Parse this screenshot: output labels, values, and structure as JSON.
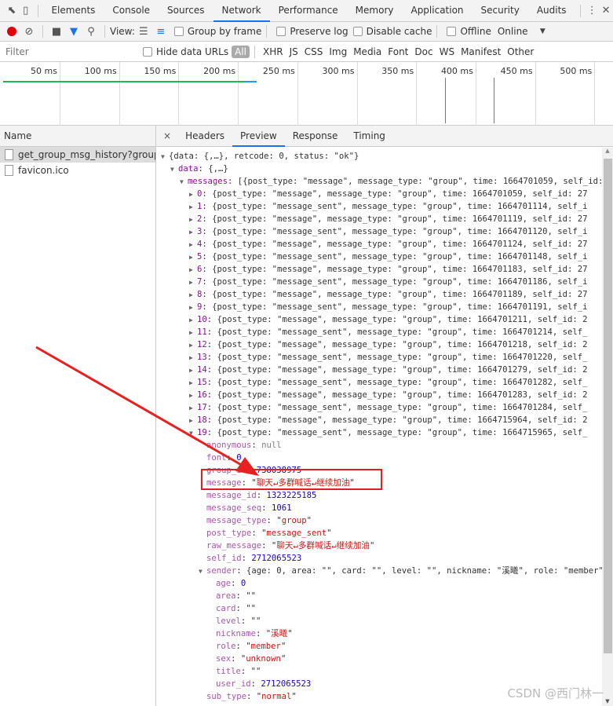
{
  "tabs": [
    "Elements",
    "Console",
    "Sources",
    "Network",
    "Performance",
    "Memory",
    "Application",
    "Security",
    "Audits"
  ],
  "active_tab": "Network",
  "toolbar": {
    "view_label": "View:",
    "group_by_frame": "Group by frame",
    "preserve_log": "Preserve log",
    "disable_cache": "Disable cache",
    "offline": "Offline",
    "throttle": "Online"
  },
  "filter": {
    "placeholder": "Filter",
    "hide_data_urls": "Hide data URLs",
    "types": [
      "All",
      "XHR",
      "JS",
      "CSS",
      "Img",
      "Media",
      "Font",
      "Doc",
      "WS",
      "Manifest",
      "Other"
    ]
  },
  "timeline": {
    "ticks": [
      "50 ms",
      "100 ms",
      "150 ms",
      "200 ms",
      "250 ms",
      "300 ms",
      "350 ms",
      "400 ms",
      "450 ms",
      "500 ms"
    ]
  },
  "requests": {
    "header": "Name",
    "items": [
      "get_group_msg_history?group...",
      "favicon.ico"
    ],
    "selected": 0
  },
  "detail_tabs": [
    "Headers",
    "Preview",
    "Response",
    "Timing"
  ],
  "active_detail_tab": "Preview",
  "colors": {
    "accent": "#1a73e8",
    "record": "#e00000",
    "highlight_box": "#e02020"
  },
  "preview": [
    {
      "i": 0,
      "a": "down",
      "t": [
        [
          "p",
          "{data: {,…}, retcode: 0, status: \"ok\"}"
        ]
      ]
    },
    {
      "i": 1,
      "a": "down",
      "t": [
        [
          "k",
          "data"
        ],
        [
          "p",
          ": {,…}"
        ]
      ]
    },
    {
      "i": 2,
      "a": "down",
      "t": [
        [
          "k",
          "messages"
        ],
        [
          "p",
          ": [{post_type: \"message\", message_type: \"group\", time: 1664701059, self_id: 2712065523"
        ]
      ]
    },
    {
      "i": 3,
      "a": "right",
      "t": [
        [
          "k",
          "0"
        ],
        [
          "p",
          ": {post_type: \"message\", message_type: \"group\", time: 1664701059, self_id: 27"
        ]
      ]
    },
    {
      "i": 3,
      "a": "right",
      "t": [
        [
          "k",
          "1"
        ],
        [
          "p",
          ": {post_type: \"message_sent\", message_type: \"group\", time: 1664701114, self_i"
        ]
      ]
    },
    {
      "i": 3,
      "a": "right",
      "t": [
        [
          "k",
          "2"
        ],
        [
          "p",
          ": {post_type: \"message\", message_type: \"group\", time: 1664701119, self_id: 27"
        ]
      ]
    },
    {
      "i": 3,
      "a": "right",
      "t": [
        [
          "k",
          "3"
        ],
        [
          "p",
          ": {post_type: \"message_sent\", message_type: \"group\", time: 1664701120, self_i"
        ]
      ]
    },
    {
      "i": 3,
      "a": "right",
      "t": [
        [
          "k",
          "4"
        ],
        [
          "p",
          ": {post_type: \"message\", message_type: \"group\", time: 1664701124, self_id: 27"
        ]
      ]
    },
    {
      "i": 3,
      "a": "right",
      "t": [
        [
          "k",
          "5"
        ],
        [
          "p",
          ": {post_type: \"message_sent\", message_type: \"group\", time: 1664701148, self_i"
        ]
      ]
    },
    {
      "i": 3,
      "a": "right",
      "t": [
        [
          "k",
          "6"
        ],
        [
          "p",
          ": {post_type: \"message\", message_type: \"group\", time: 1664701183, self_id: 27"
        ]
      ]
    },
    {
      "i": 3,
      "a": "right",
      "t": [
        [
          "k",
          "7"
        ],
        [
          "p",
          ": {post_type: \"message_sent\", message_type: \"group\", time: 1664701186, self_i"
        ]
      ]
    },
    {
      "i": 3,
      "a": "right",
      "t": [
        [
          "k",
          "8"
        ],
        [
          "p",
          ": {post_type: \"message\", message_type: \"group\", time: 1664701189, self_id: 27"
        ]
      ]
    },
    {
      "i": 3,
      "a": "right",
      "t": [
        [
          "k",
          "9"
        ],
        [
          "p",
          ": {post_type: \"message_sent\", message_type: \"group\", time: 1664701191, self_i"
        ]
      ]
    },
    {
      "i": 3,
      "a": "right",
      "t": [
        [
          "k",
          "10"
        ],
        [
          "p",
          ": {post_type: \"message\", message_type: \"group\", time: 1664701211, self_id: 2"
        ]
      ]
    },
    {
      "i": 3,
      "a": "right",
      "t": [
        [
          "k",
          "11"
        ],
        [
          "p",
          ": {post_type: \"message_sent\", message_type: \"group\", time: 1664701214, self_"
        ]
      ]
    },
    {
      "i": 3,
      "a": "right",
      "t": [
        [
          "k",
          "12"
        ],
        [
          "p",
          ": {post_type: \"message\", message_type: \"group\", time: 1664701218, self_id: 2"
        ]
      ]
    },
    {
      "i": 3,
      "a": "right",
      "t": [
        [
          "k",
          "13"
        ],
        [
          "p",
          ": {post_type: \"message_sent\", message_type: \"group\", time: 1664701220, self_"
        ]
      ]
    },
    {
      "i": 3,
      "a": "right",
      "t": [
        [
          "k",
          "14"
        ],
        [
          "p",
          ": {post_type: \"message\", message_type: \"group\", time: 1664701279, self_id: 2"
        ]
      ]
    },
    {
      "i": 3,
      "a": "right",
      "t": [
        [
          "k",
          "15"
        ],
        [
          "p",
          ": {post_type: \"message_sent\", message_type: \"group\", time: 1664701282, self_"
        ]
      ]
    },
    {
      "i": 3,
      "a": "right",
      "t": [
        [
          "k",
          "16"
        ],
        [
          "p",
          ": {post_type: \"message\", message_type: \"group\", time: 1664701283, self_id: 2"
        ]
      ]
    },
    {
      "i": 3,
      "a": "right",
      "t": [
        [
          "k",
          "17"
        ],
        [
          "p",
          ": {post_type: \"message_sent\", message_type: \"group\", time: 1664701284, self_"
        ]
      ]
    },
    {
      "i": 3,
      "a": "right",
      "t": [
        [
          "k",
          "18"
        ],
        [
          "p",
          ": {post_type: \"message\", message_type: \"group\", time: 1664715964, self_id: 2"
        ]
      ]
    },
    {
      "i": 3,
      "a": "down",
      "t": [
        [
          "k",
          "19"
        ],
        [
          "p",
          ": {post_type: \"message_sent\", message_type: \"group\", time: 1664715965, self_"
        ]
      ]
    },
    {
      "i": 4,
      "a": "",
      "t": [
        [
          "k2",
          "anonymous"
        ],
        [
          "p",
          ": "
        ],
        [
          "nl",
          "null"
        ]
      ]
    },
    {
      "i": 4,
      "a": "",
      "t": [
        [
          "k2",
          "font"
        ],
        [
          "p",
          ": "
        ],
        [
          "n",
          "0"
        ]
      ]
    },
    {
      "i": 4,
      "a": "",
      "t": [
        [
          "k2",
          "group_id"
        ],
        [
          "p",
          ": "
        ],
        [
          "n",
          "738038975"
        ]
      ]
    },
    {
      "i": 4,
      "a": "",
      "t": [
        [
          "k2",
          "message"
        ],
        [
          "p",
          ": \""
        ],
        [
          "s",
          "聊天↵多群喊话↵继续加油"
        ],
        [
          "p",
          "\""
        ]
      ]
    },
    {
      "i": 4,
      "a": "",
      "t": [
        [
          "k2",
          "message_id"
        ],
        [
          "p",
          ": "
        ],
        [
          "n",
          "1323225185"
        ]
      ]
    },
    {
      "i": 4,
      "a": "",
      "t": [
        [
          "k2",
          "message_seq"
        ],
        [
          "p",
          ": "
        ],
        [
          "n",
          "1061"
        ]
      ]
    },
    {
      "i": 4,
      "a": "",
      "t": [
        [
          "k2",
          "message_type"
        ],
        [
          "p",
          ": \""
        ],
        [
          "s",
          "group"
        ],
        [
          "p",
          "\""
        ]
      ]
    },
    {
      "i": 4,
      "a": "",
      "t": [
        [
          "k2",
          "post_type"
        ],
        [
          "p",
          ": \""
        ],
        [
          "s",
          "message_sent"
        ],
        [
          "p",
          "\""
        ]
      ]
    },
    {
      "i": 4,
      "a": "",
      "t": [
        [
          "k2",
          "raw_message"
        ],
        [
          "p",
          ": \""
        ],
        [
          "s",
          "聊天↵多群喊话↵继续加油"
        ],
        [
          "p",
          "\""
        ]
      ]
    },
    {
      "i": 4,
      "a": "",
      "t": [
        [
          "k2",
          "self_id"
        ],
        [
          "p",
          ": "
        ],
        [
          "n",
          "2712065523"
        ]
      ]
    },
    {
      "i": 4,
      "a": "down",
      "t": [
        [
          "k2",
          "sender"
        ],
        [
          "p",
          ": {age: 0, area: \"\", card: \"\", level: \"\", nickname: \"溪曦\", role: \"member\""
        ]
      ]
    },
    {
      "i": 5,
      "a": "",
      "t": [
        [
          "k2",
          "age"
        ],
        [
          "p",
          ": "
        ],
        [
          "n",
          "0"
        ]
      ]
    },
    {
      "i": 5,
      "a": "",
      "t": [
        [
          "k2",
          "area"
        ],
        [
          "p",
          ": \"\""
        ]
      ]
    },
    {
      "i": 5,
      "a": "",
      "t": [
        [
          "k2",
          "card"
        ],
        [
          "p",
          ": \"\""
        ]
      ]
    },
    {
      "i": 5,
      "a": "",
      "t": [
        [
          "k2",
          "level"
        ],
        [
          "p",
          ": \"\""
        ]
      ]
    },
    {
      "i": 5,
      "a": "",
      "t": [
        [
          "k2",
          "nickname"
        ],
        [
          "p",
          ": \""
        ],
        [
          "s",
          "溪曦"
        ],
        [
          "p",
          "\""
        ]
      ]
    },
    {
      "i": 5,
      "a": "",
      "t": [
        [
          "k2",
          "role"
        ],
        [
          "p",
          ": \""
        ],
        [
          "s",
          "member"
        ],
        [
          "p",
          "\""
        ]
      ]
    },
    {
      "i": 5,
      "a": "",
      "t": [
        [
          "k2",
          "sex"
        ],
        [
          "p",
          ": \""
        ],
        [
          "s",
          "unknown"
        ],
        [
          "p",
          "\""
        ]
      ]
    },
    {
      "i": 5,
      "a": "",
      "t": [
        [
          "k2",
          "title"
        ],
        [
          "p",
          ": \"\""
        ]
      ]
    },
    {
      "i": 5,
      "a": "",
      "t": [
        [
          "k2",
          "user_id"
        ],
        [
          "p",
          ": "
        ],
        [
          "n",
          "2712065523"
        ]
      ]
    },
    {
      "i": 4,
      "a": "",
      "t": [
        [
          "k2",
          "sub_type"
        ],
        [
          "p",
          ": \""
        ],
        [
          "s",
          "normal"
        ],
        [
          "p",
          "\""
        ]
      ]
    }
  ],
  "watermark": "CSDN @西门林一"
}
